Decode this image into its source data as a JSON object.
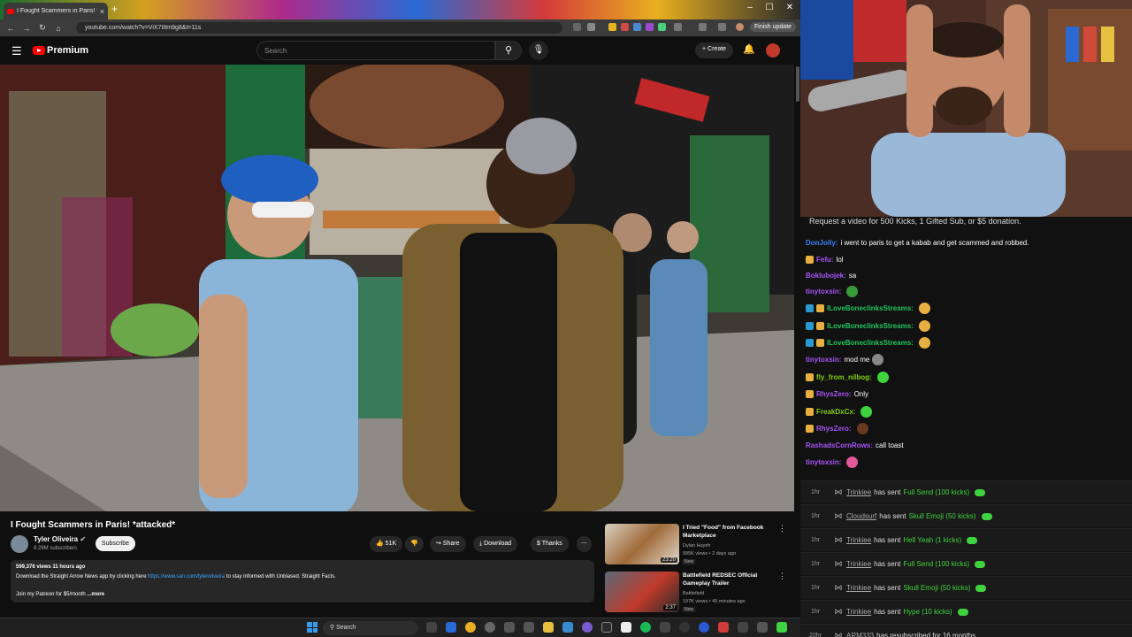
{
  "browser": {
    "tab_title": "I Fought Scammers in Paris! *at",
    "url": "youtube.com/watch?v=ViX7tItm9g8&t=11s",
    "finish_update": "Finish update"
  },
  "youtube": {
    "brand": "Premium",
    "search_placeholder": "Search",
    "create_label": "Create"
  },
  "video": {
    "title": "I Fought Scammers in Paris! *attacked*",
    "channel": "Tyler Oliveira",
    "subscribers": "8.29M subscribers",
    "subscribe_label": "Subscribe",
    "likes": "51K",
    "share_label": "Share",
    "download_label": "Download",
    "thanks_label": "Thanks",
    "more_label": "⋯",
    "views_age": "599,376 views  11 hours ago",
    "desc_pre": "Download the Straight Arrow News app by clicking here ",
    "desc_link": "https://www.san.com/tyleroliveira",
    "desc_post": " to stay informed with Unbiased. Straight Facts.",
    "desc_line2": "Join my Patreon for $5/month",
    "desc_more": "...more"
  },
  "recommendations": [
    {
      "title": "I Tried \"Food\" from Facebook Marketplace",
      "channel": "Dylan Huynh",
      "meta": "995K views • 2 days ago",
      "badge": "New",
      "duration": "23:20"
    },
    {
      "title": "Battlefield REDSEC Official Gameplay Trailer",
      "channel": "Battlefield",
      "meta": "197K views • 49 minutes ago",
      "badge": "New",
      "duration": "2:37"
    }
  ],
  "taskbar": {
    "search": "Search"
  },
  "chat": {
    "header": "Request a video for 500 Kicks, 1 Gifted Sub, or $5 donation.",
    "messages": [
      {
        "user": "DonJolly:",
        "text": "i went to paris to get a kabab and get scammed and robbed.",
        "color": "#3b82f6"
      },
      {
        "user": "Fefu:",
        "text": "lol",
        "color": "#a855f7"
      },
      {
        "user": "Boklubojek:",
        "text": "sa",
        "color": "#a855f7"
      },
      {
        "user": "tinytoxsin:",
        "text": "",
        "color": "#a855f7"
      },
      {
        "user": "ILoveBoneclinksStreams:",
        "text": "",
        "color": "#22c55e"
      },
      {
        "user": "ILoveBoneclinksStreams:",
        "text": "",
        "color": "#22c55e"
      },
      {
        "user": "ILoveBoneclinksStreams:",
        "text": "",
        "color": "#22c55e"
      },
      {
        "user": "tinytoxsin:",
        "text": "mod me",
        "color": "#a855f7"
      },
      {
        "user": "fly_from_nilbog:",
        "text": "",
        "color": "#84cc16"
      },
      {
        "user": "RhysZero:",
        "text": "Only",
        "color": "#a855f7"
      },
      {
        "user": "FreakDxCx:",
        "text": "",
        "color": "#84cc16"
      },
      {
        "user": "RhysZero:",
        "text": "",
        "color": "#a855f7"
      },
      {
        "user": "RashadsCornRows:",
        "text": "call toast",
        "color": "#a855f7"
      },
      {
        "user": "tinytoxsin:",
        "text": "",
        "color": "#a855f7"
      }
    ]
  },
  "events": [
    {
      "time": "1hr",
      "user": "Trinkiee",
      "verb": "has sent",
      "gift": "Full Send (100 kicks)"
    },
    {
      "time": "1hr",
      "user": "Cloudsurf",
      "verb": "has sent",
      "gift": "Skull Emoji (50 kicks)"
    },
    {
      "time": "1hr",
      "user": "Trinkiee",
      "verb": "has sent",
      "gift": "Hell Yeah (1 kicks)"
    },
    {
      "time": "1hr",
      "user": "Trinkiee",
      "verb": "has sent",
      "gift": "Full Send (100 kicks)"
    },
    {
      "time": "1hr",
      "user": "Trinkiee",
      "verb": "has sent",
      "gift": "Skull Emoji (50 kicks)"
    },
    {
      "time": "1hr",
      "user": "Trinkiee",
      "verb": "has sent",
      "gift": "Hype (10 kicks)"
    },
    {
      "time": "20hr",
      "user": "ARM333",
      "verb": "has resubscribed for 16 months",
      "gift": ""
    }
  ]
}
